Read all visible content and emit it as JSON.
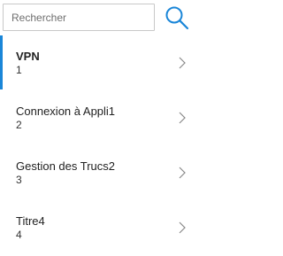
{
  "search": {
    "placeholder": "Rechercher",
    "value": "",
    "icon": "search-icon",
    "accent_color": "#1a86d8"
  },
  "list": {
    "selected_index": 0,
    "selection_color": "#1a86d8",
    "items": [
      {
        "title": "VPN",
        "subtitle": "1"
      },
      {
        "title": "Connexion à Appli1",
        "subtitle": "2"
      },
      {
        "title": "Gestion des Trucs2",
        "subtitle": "3"
      },
      {
        "title": "Titre4",
        "subtitle": "4"
      }
    ],
    "item_icon": "chevron-right-icon"
  }
}
